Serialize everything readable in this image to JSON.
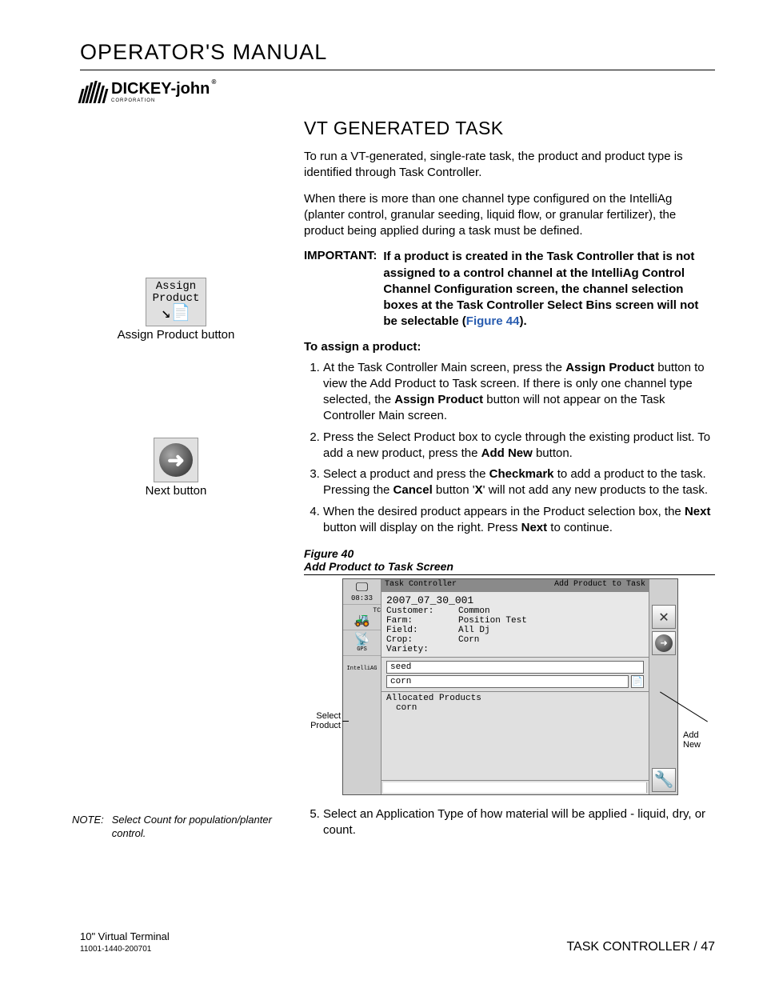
{
  "doc_title": "OPERATOR'S MANUAL",
  "brand": "DICKEY-john",
  "brand_reg": "®",
  "brand_sub": "CORPORATION",
  "sidebar": {
    "assign_label_line1": "Assign",
    "assign_label_line2": "Product",
    "assign_caption": "Assign Product button",
    "next_caption": "Next button",
    "note_label": "NOTE:",
    "note_text": "Select Count for population/planter control."
  },
  "section_heading": "VT GENERATED TASK",
  "para1": "To run a VT-generated, single-rate task, the product and product type is identified through Task Controller.",
  "para2": "When there is more than one channel type configured on the IntelliAg (planter control, granular seeding, liquid flow, or granular fertilizer), the product being applied during a task must be defined.",
  "important_label": "IMPORTANT:",
  "important_text_a": "If a product is created in the Task Controller that is not assigned to a control channel at the IntelliAg Control Channel Configuration screen, the channel selection boxes at the Task Controller Select Bins screen will not be selectable (",
  "important_fig_ref": "Figure 44",
  "important_text_b": ").",
  "assign_heading": "To assign a product:",
  "steps": {
    "s1a": "At the Task Controller Main screen, press the ",
    "s1b": "Assign Product",
    "s1c": " button to view the Add Product to Task screen. If there is only one channel type selected, the ",
    "s1d": "Assign Product",
    "s1e": " button will not appear on the Task Controller Main screen.",
    "s2a": "Press the Select Product box to cycle through the existing product list. To add a new product, press the ",
    "s2b": "Add New",
    "s2c": " button.",
    "s3a": "Select a product and press the ",
    "s3b": "Checkmark",
    "s3c": " to add a product to the task. Pressing the ",
    "s3d": "Cancel",
    "s3e": " button '",
    "s3f": "X",
    "s3g": "' will not add any new products to the task.",
    "s4a": "When the desired product appears in the Product selection box, the ",
    "s4b": "Next",
    "s4c": " button will display on the right. Press ",
    "s4d": "Next",
    "s4e": " to continue.",
    "s5": "Select an Application Type of how material will be applied - liquid, dry, or count."
  },
  "figure": {
    "label": "Figure 40",
    "caption": "Add Product to Task Screen",
    "callout_left": "Select Product",
    "callout_right": "Add New",
    "title_left": "Task Controller",
    "title_right": "Add Product to Task",
    "task_id": "2007_07_30_001",
    "labels": {
      "customer": "Customer:",
      "farm": "Farm:",
      "field": "Field:",
      "crop": "Crop:",
      "variety": "Variety:"
    },
    "values": {
      "customer": "Common",
      "farm": "Position Test",
      "field": "All Dj",
      "crop": "Corn",
      "variety": ""
    },
    "sel1": "seed",
    "sel2": "corn",
    "alloc_label": "Allocated Products",
    "alloc_item": "corn",
    "left_icons": {
      "time": "08:33",
      "tc": "TC",
      "gps": "GPS",
      "intelliag": "IntelliAG"
    }
  },
  "footer": {
    "product": "10\" Virtual Terminal",
    "partno": "11001-1440-200701",
    "section": "TASK CONTROLLER",
    "page": "47"
  }
}
